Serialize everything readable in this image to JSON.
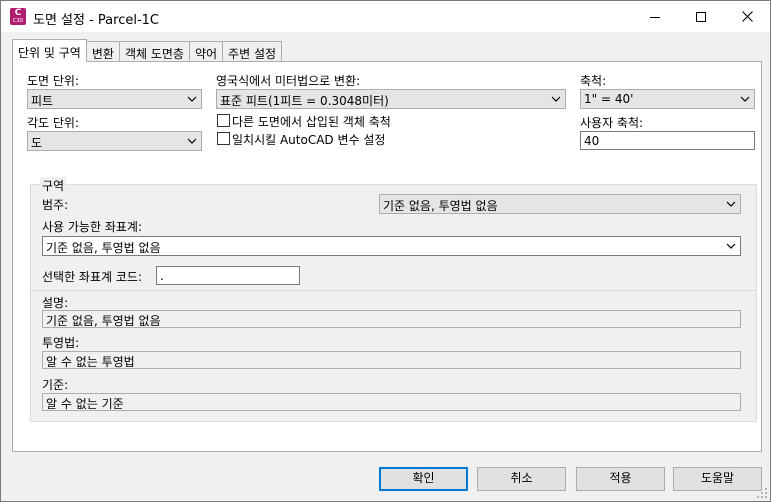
{
  "window": {
    "title": "도면 설정 - Parcel-1C",
    "app_icon": {
      "letter": "C",
      "sub": "C3D"
    }
  },
  "tabs": [
    {
      "label": "단위 및 구역",
      "active": true
    },
    {
      "label": "변환",
      "active": false
    },
    {
      "label": "객체 도면층",
      "active": false
    },
    {
      "label": "약어",
      "active": false
    },
    {
      "label": "주변 설정",
      "active": false
    }
  ],
  "units": {
    "drawing_units_label": "도면 단위:",
    "drawing_units_value": "피트",
    "angular_units_label": "각도 단위:",
    "angular_units_value": "도",
    "imperial_to_metric_label": "영국식에서 미터법으로 변환:",
    "imperial_to_metric_value": "표준 피트(1피트 = 0.3048미터)",
    "scale_objects_label": "다른 도면에서 삽입된 객체 축척",
    "set_autocad_vars_label": "일치시킬 AutoCAD 변수 설정",
    "scale_label": "축척:",
    "scale_value": "1\" = 40'",
    "custom_scale_label": "사용자 축척:",
    "custom_scale_value": "40"
  },
  "zone": {
    "group_title": "구역",
    "category_label": "범주:",
    "category_value": "기준 없음, 투영법 없음",
    "available_cs_label": "사용 가능한 좌표계:",
    "available_cs_value": "기준 없음, 투영법 없음",
    "selected_code_label": "선택한 좌표계 코드:",
    "selected_code_value": ".",
    "description_label": "설명:",
    "description_value": "기준 없음, 투영법 없음",
    "projection_label": "투영법:",
    "projection_value": "알 수 없는 투영법",
    "datum_label": "기준:",
    "datum_value": "알 수 없는 기준"
  },
  "buttons": {
    "ok": "확인",
    "cancel": "취소",
    "apply": "적용",
    "help": "도움말"
  }
}
